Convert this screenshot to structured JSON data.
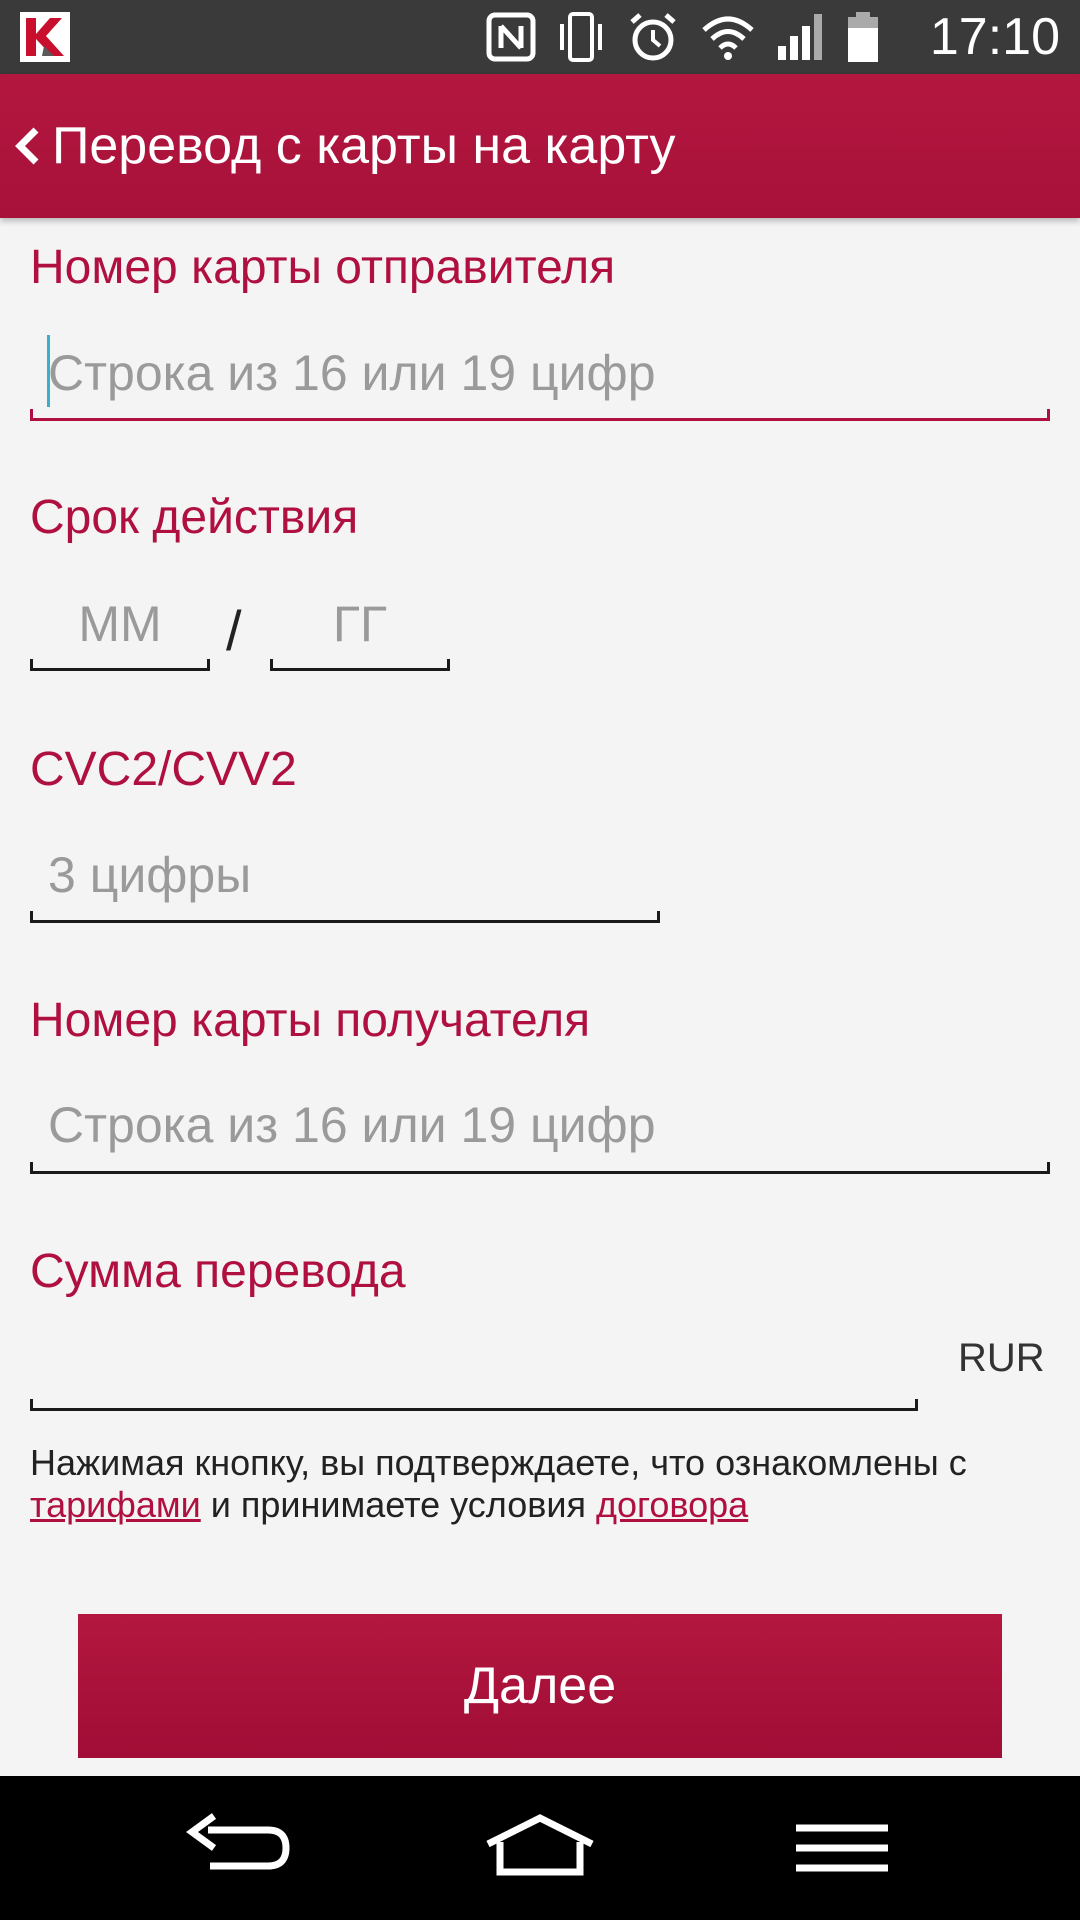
{
  "status_bar": {
    "time": "17:10",
    "icons": [
      "kaspersky-icon",
      "nfc-icon",
      "vibrate-icon",
      "alarm-icon",
      "wifi-icon",
      "signal-icon",
      "battery-icon"
    ]
  },
  "app_bar": {
    "title": "Перевод с карты на карту"
  },
  "form": {
    "sender_card": {
      "label": "Номер карты отправителя",
      "placeholder": "Строка из 16 или 19 цифр",
      "value": ""
    },
    "expiry": {
      "label": "Срок действия",
      "month_placeholder": "ММ",
      "separator": "/",
      "year_placeholder": "ГГ"
    },
    "cvc": {
      "label": "CVC2/CVV2",
      "placeholder": "3 цифры"
    },
    "recipient_card": {
      "label": "Номер карты получателя",
      "placeholder": "Строка из 16 или 19 цифр"
    },
    "amount": {
      "label": "Сумма перевода",
      "value": "",
      "currency": "RUR"
    }
  },
  "terms": {
    "prefix": "Нажимая кнопку, вы подтверждаете, что ознакомлены с ",
    "tariffs_link": "тарифами",
    "middle": " и принимаете условия ",
    "contract_link": "договора"
  },
  "next_button": {
    "label": "Далее"
  },
  "colors": {
    "accent": "#b01040",
    "status_bar": "#3a3a3a",
    "nav_bar": "#000000"
  }
}
